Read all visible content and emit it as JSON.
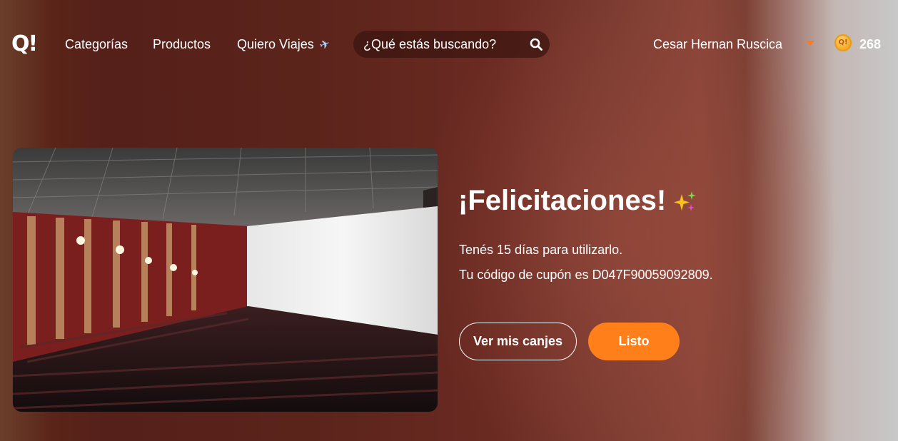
{
  "header": {
    "logo_text": "Q!",
    "nav": {
      "categorias": "Categorías",
      "productos": "Productos",
      "quiero_viajes": "Quiero Viajes"
    },
    "nav_icons": {
      "quiero_viajes": "airplane-icon"
    },
    "search": {
      "placeholder": "¿Qué estás buscando?",
      "value": "",
      "icon": "search-icon"
    },
    "user": {
      "name": "Cesar Hernan Ruscica",
      "dropdown_icon": "caret-down-icon"
    },
    "points": {
      "coin_icon": "coin-icon",
      "coin_text": "Q!",
      "value": "268"
    }
  },
  "main": {
    "image_icon": "cinema-theater-photo",
    "title": "¡Felicitaciones!",
    "title_icon": "sparkles-icon",
    "line1": "Tenés 15 días para utilizarlo.",
    "line2": "Tu código de cupón es D047F90059092809.",
    "buttons": {
      "secondary": "Ver mis canjes",
      "primary": "Listo"
    }
  },
  "colors": {
    "accent": "#ff7f1a",
    "background": "#5b241b",
    "text": "#ffffff"
  }
}
